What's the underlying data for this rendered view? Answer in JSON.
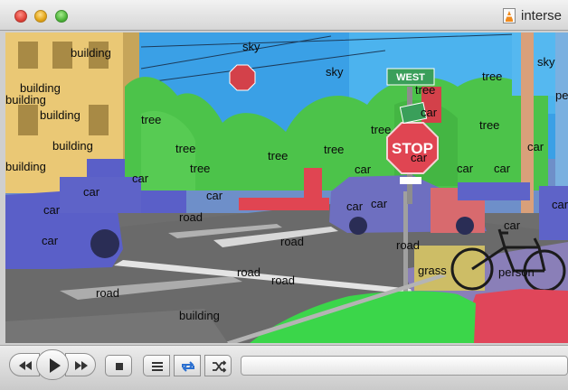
{
  "window": {
    "title": "interse"
  },
  "icons": {
    "close": "close-icon",
    "minimize": "minimize-icon",
    "zoom": "zoom-icon",
    "document": "vlc-document-icon",
    "rewind": "rewind-icon",
    "play": "play-icon",
    "forward": "fast-forward-icon",
    "stop": "stop-icon",
    "playlist": "playlist-icon",
    "repeat": "repeat-icon",
    "shuffle": "shuffle-icon"
  },
  "colors": {
    "sky": "#3aa0e6",
    "building": "#e7c26a",
    "tree": "#4cc34a",
    "car": "#5e63c8",
    "road": "#6e6e6e",
    "sign": "#d3414a",
    "person": "#e0465a",
    "grass": "#3bd64a",
    "repeat_active": "#2a6fd0"
  },
  "labels": [
    {
      "text": "building"
    },
    {
      "text": "sky"
    },
    {
      "text": "sky"
    },
    {
      "text": "sky"
    },
    {
      "text": "building"
    },
    {
      "text": "building"
    },
    {
      "text": "building"
    },
    {
      "text": "building"
    },
    {
      "text": "building"
    },
    {
      "text": "tree"
    },
    {
      "text": "tree"
    },
    {
      "text": "tree"
    },
    {
      "text": "tree"
    },
    {
      "text": "tree"
    },
    {
      "text": "tree"
    },
    {
      "text": "tree"
    },
    {
      "text": "tree"
    },
    {
      "text": "tree"
    },
    {
      "text": "person"
    },
    {
      "text": "car"
    },
    {
      "text": "car"
    },
    {
      "text": "car"
    },
    {
      "text": "car"
    },
    {
      "text": "car"
    },
    {
      "text": "car"
    },
    {
      "text": "car"
    },
    {
      "text": "car"
    },
    {
      "text": "car"
    },
    {
      "text": "car"
    },
    {
      "text": "car"
    },
    {
      "text": "car"
    },
    {
      "text": "car"
    },
    {
      "text": "car"
    },
    {
      "text": "car"
    },
    {
      "text": "road"
    },
    {
      "text": "road"
    },
    {
      "text": "road"
    },
    {
      "text": "road"
    },
    {
      "text": "road"
    },
    {
      "text": "road"
    },
    {
      "text": "building"
    },
    {
      "text": "grass"
    },
    {
      "text": "person"
    }
  ]
}
